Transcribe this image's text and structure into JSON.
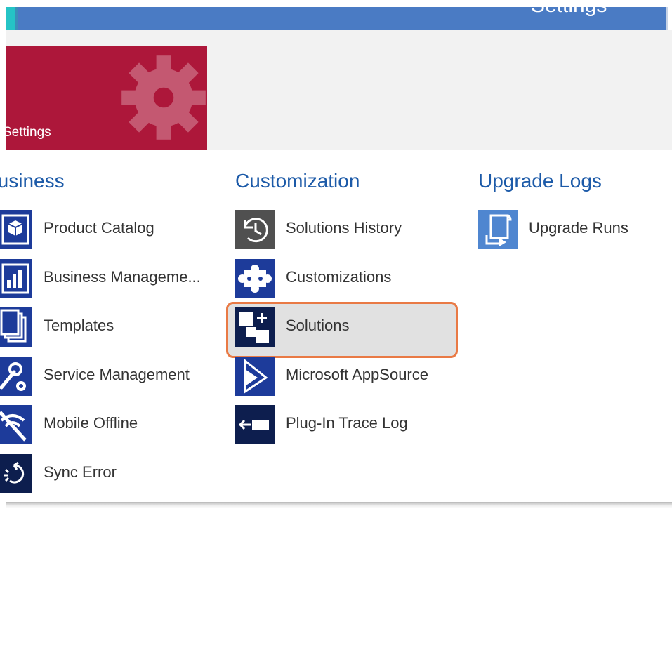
{
  "header": {
    "title": "Settings"
  },
  "tile": {
    "label": "Settings",
    "icon": "gear-icon",
    "color": "#ad173a"
  },
  "columns": {
    "business": {
      "heading": "Business",
      "items": [
        {
          "label": "Product Catalog",
          "icon": "product-catalog-icon"
        },
        {
          "label": "Business Manageme...",
          "icon": "business-management-icon"
        },
        {
          "label": "Templates",
          "icon": "templates-icon"
        },
        {
          "label": "Service Management",
          "icon": "service-management-icon"
        },
        {
          "label": "Mobile Offline",
          "icon": "mobile-offline-icon"
        },
        {
          "label": "Sync Error",
          "icon": "sync-error-icon"
        }
      ]
    },
    "customization": {
      "heading": "Customization",
      "items": [
        {
          "label": "Solutions History",
          "icon": "history-icon"
        },
        {
          "label": "Customizations",
          "icon": "puzzle-icon"
        },
        {
          "label": "Solutions",
          "icon": "solutions-icon",
          "highlighted": true
        },
        {
          "label": "Microsoft AppSource",
          "icon": "dynamics-icon"
        },
        {
          "label": "Plug-In Trace Log",
          "icon": "trace-log-icon"
        }
      ]
    },
    "upgrade_logs": {
      "heading": "Upgrade Logs",
      "items": [
        {
          "label": "Upgrade Runs",
          "icon": "upgrade-runs-icon"
        }
      ]
    }
  },
  "colors": {
    "header": "#4a7bc4",
    "heading_text": "#1c5aa8",
    "highlight_border": "#e97a45"
  }
}
